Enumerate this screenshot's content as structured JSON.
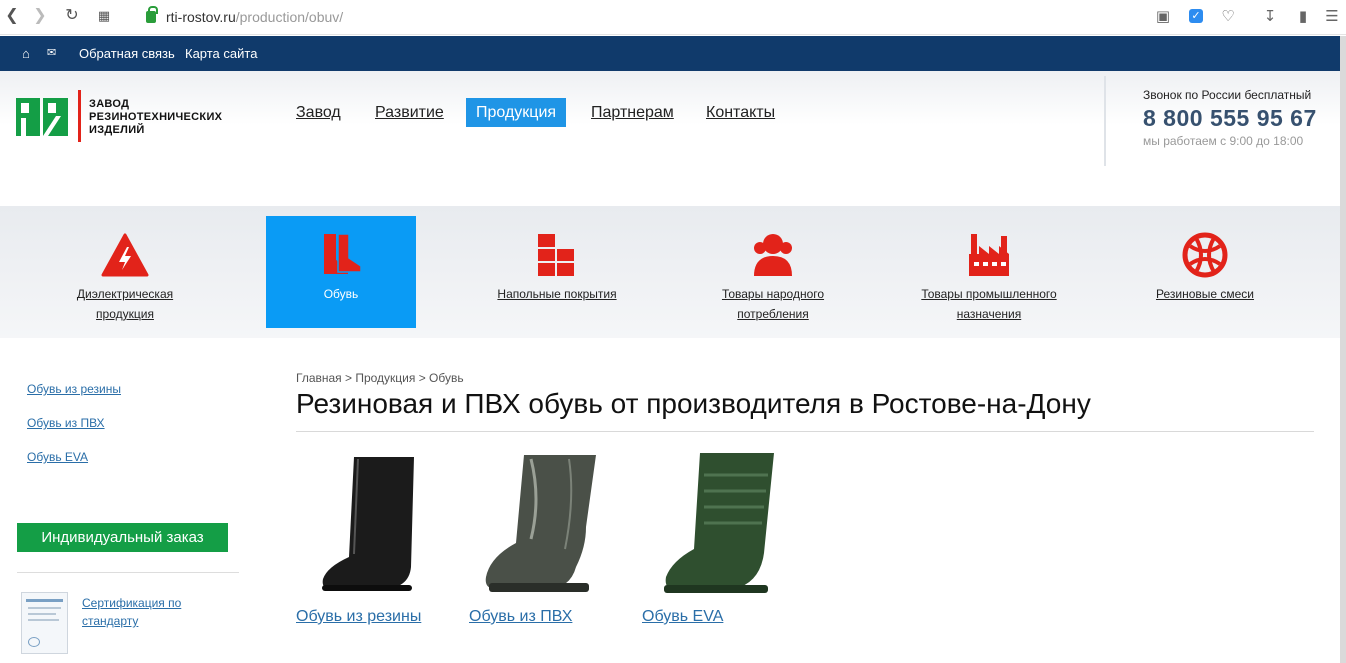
{
  "browser": {
    "url_host": "rti-rostov.ru",
    "url_path": "/production/obuv/"
  },
  "topbar": {
    "feedback": "Обратная связь",
    "sitemap": "Карта сайта"
  },
  "logo": {
    "line1": "ЗАВОД",
    "line2": "РЕЗИНОТЕХНИЧЕСКИХ",
    "line3": "ИЗДЕЛИЙ"
  },
  "menu": {
    "items": [
      {
        "label": "Завод"
      },
      {
        "label": "Развитие"
      },
      {
        "label": "Продукция"
      },
      {
        "label": "Партнерам"
      },
      {
        "label": "Контакты"
      }
    ],
    "active": "Продукция"
  },
  "contact": {
    "caption": "Звонок по России бесплатный",
    "phone": "8 800 555 95 67",
    "hours": "мы работаем с 9:00 до 18:00"
  },
  "categories": [
    {
      "label1": "Диэлектрическая",
      "label2": "продукция",
      "icon": "warning-lightning-icon"
    },
    {
      "label1": "Обувь",
      "label2": "",
      "icon": "boots-icon"
    },
    {
      "label1": "Напольные покрытия",
      "label2": "",
      "icon": "floor-tiles-icon"
    },
    {
      "label1": "Товары народного",
      "label2": "потребления",
      "icon": "people-icon"
    },
    {
      "label1": "Товары промышленного",
      "label2": "назначения",
      "icon": "factory-icon"
    },
    {
      "label1": "Резиновые смеси",
      "label2": "",
      "icon": "rubber-mix-icon"
    }
  ],
  "sidebar": {
    "links": [
      "Обувь из резины",
      "Обувь из ПВХ",
      "Обувь EVA"
    ],
    "order_button": "Индивидуальный заказ",
    "cert_link": "Сертификация по стандарту"
  },
  "main": {
    "breadcrumb": "Главная > Продукция > Обувь",
    "title": "Резиновая и ПВХ обувь от производителя в Ростове-на-Дону",
    "products": [
      {
        "label": "Обувь из резины",
        "color": "#1b1b1b"
      },
      {
        "label": "Обувь из ПВХ",
        "color": "#4a5048"
      },
      {
        "label": "Обувь EVA",
        "color": "#2f4f2f"
      }
    ]
  },
  "colors": {
    "topbar": "#103a6b",
    "accent_blue": "#1f95e6",
    "category_active": "#0a9bf5",
    "icon_red": "#e2231a",
    "order_green": "#149e46",
    "phone": "#37516f"
  }
}
